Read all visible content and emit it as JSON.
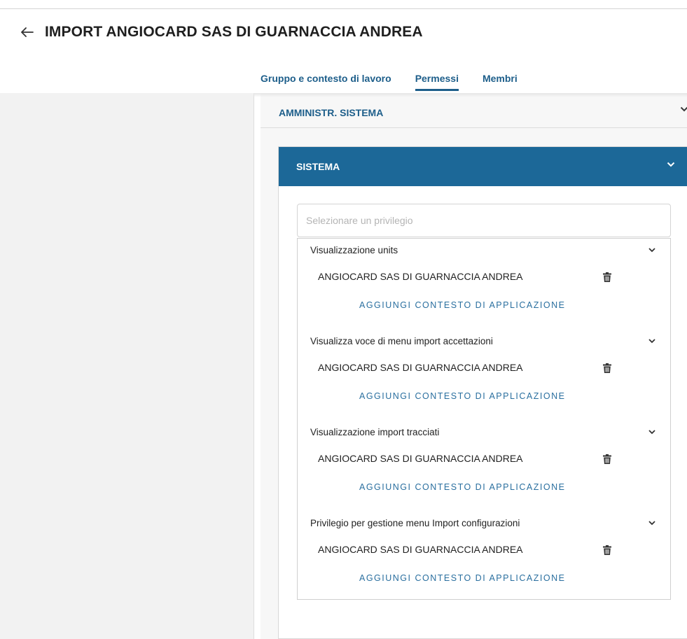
{
  "header": {
    "title": "IMPORT ANGIOCARD SAS DI GUARNACCIA ANDREA",
    "back_icon": "arrow-left-icon"
  },
  "tabs": [
    {
      "label": "Gruppo e contesto di lavoro",
      "active": false
    },
    {
      "label": "Permessi",
      "active": true
    },
    {
      "label": "Membri",
      "active": false
    }
  ],
  "sections": {
    "amministr": {
      "title": "AMMINISTR. SISTEMA"
    },
    "sistema": {
      "title": "SISTEMA",
      "privilege_placeholder": "Selezionare un privilegio",
      "privileges": [
        {
          "name": "Visualizzazione units",
          "context": "ANGIOCARD SAS DI GUARNACCIA ANDREA",
          "add_label": "AGGIUNGI CONTESTO DI APPLICAZIONE"
        },
        {
          "name": "Visualizza voce di menu import accettazioni",
          "context": "ANGIOCARD SAS DI GUARNACCIA ANDREA",
          "add_label": "AGGIUNGI CONTESTO DI APPLICAZIONE"
        },
        {
          "name": "Visualizzazione import tracciati",
          "context": "ANGIOCARD SAS DI GUARNACCIA ANDREA",
          "add_label": "AGGIUNGI CONTESTO DI APPLICAZIONE"
        },
        {
          "name": "Privilegio per gestione menu Import configurazioni",
          "context": "ANGIOCARD SAS DI GUARNACCIA ANDREA",
          "add_label": "AGGIUNGI CONTESTO DI APPLICAZIONE"
        }
      ]
    }
  },
  "colors": {
    "accent": "#1c6898",
    "tab_text": "#1d5e8a",
    "link": "#2a6f9f"
  }
}
